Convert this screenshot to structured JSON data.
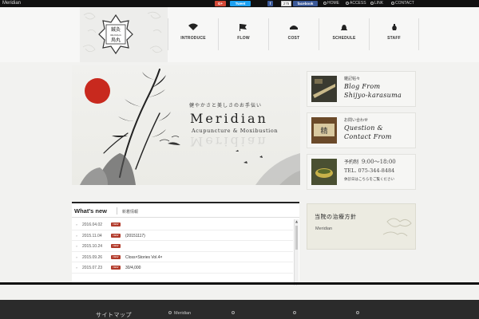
{
  "topbar": {
    "site_name": "Meridian",
    "social": {
      "gplus": "G+",
      "tweet": "Tweet",
      "fb_count": "275",
      "facebook": "facebook",
      "fb_share": "f"
    },
    "nav": [
      "HOME",
      "ACCESS",
      "LINK",
      "CONTACT"
    ]
  },
  "logo": {
    "top": "鍼灸",
    "middle": "Meridian",
    "bottom": "烏丸"
  },
  "global_nav": [
    {
      "label": "INTRODUCE",
      "icon": "fan-icon"
    },
    {
      "label": "FLOW",
      "icon": "flag-icon"
    },
    {
      "label": "COST",
      "icon": "comb-icon"
    },
    {
      "label": "SCHEDULE",
      "icon": "bell-icon"
    },
    {
      "label": "STAFF",
      "icon": "vase-icon"
    }
  ],
  "visual": {
    "tagline": "健やかさと美しさのお手伝い",
    "title": "Meridian",
    "subtitle": "Acupuncture & Moxibustion",
    "accent_color": "#c8291e"
  },
  "banners": [
    {
      "small": "雑記帖々",
      "big_line1": "Blog From",
      "big_line2": "Shijyo-karasuma"
    },
    {
      "small": "お問い合わせ",
      "big_line1": "Question &",
      "big_line2": "Contact From"
    },
    {
      "small": "予約制",
      "hours": "9:00～18:00",
      "tel": "TEL. 075-344-8484",
      "note": "休診日はこちらをご覧ください"
    }
  ],
  "news": {
    "title_en": "What's new",
    "title_ja": "新着情報",
    "badge": "NEW",
    "items": [
      {
        "date": "2016.04.02",
        "text": ""
      },
      {
        "date": "2015.11.04",
        "text": "(20151117)"
      },
      {
        "date": "2015.10.24",
        "text": ""
      },
      {
        "date": "2015.09.26",
        "text": "Closs×Stories Vol.4×"
      },
      {
        "date": "2015.07.23",
        "text": "30/4,000"
      }
    ]
  },
  "policy": {
    "title": "当院の治療方針",
    "subtitle": "Meridian"
  },
  "footer": {
    "heading": "サイトマップ",
    "columns": [
      "Meridian",
      "",
      "",
      ""
    ]
  }
}
